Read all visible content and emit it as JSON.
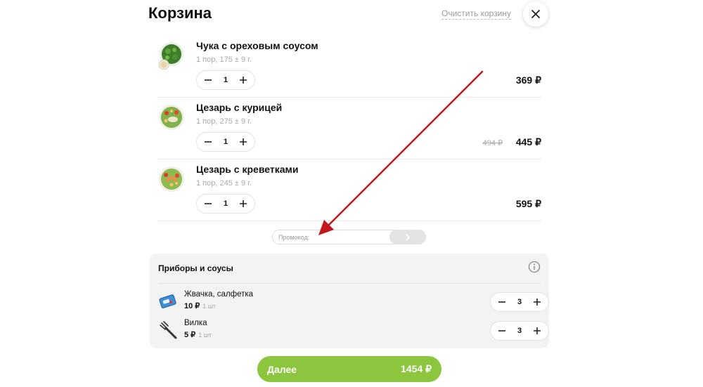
{
  "header": {
    "title": "Корзина",
    "clear_label": "Очистить корзину"
  },
  "items": [
    {
      "name": "Чука с ореховым соусом",
      "meta": "1 пор,  175 ± 9 г.",
      "qty": "1",
      "price": "369  ₽",
      "old_price": ""
    },
    {
      "name": "Цезарь с курицей",
      "meta": "1 пор,  275 ± 9 г.",
      "qty": "1",
      "price": "445  ₽",
      "old_price": "494 ₽"
    },
    {
      "name": "Цезарь с креветками",
      "meta": "1 пор,  245 ± 9 г.",
      "qty": "1",
      "price": "595  ₽",
      "old_price": ""
    }
  ],
  "promo": {
    "placeholder": "Промокод:",
    "value": ""
  },
  "extras": {
    "title": "Приборы и соусы",
    "items": [
      {
        "name": "Жвачка, салфетка",
        "price": "10 ₽",
        "unit": "1 шт",
        "qty": "3"
      },
      {
        "name": "Вилка",
        "price": "5 ₽",
        "unit": "1 шт",
        "qty": "3"
      }
    ]
  },
  "checkout": {
    "label": "Далее",
    "total": "1454 ₽"
  },
  "colors": {
    "accent": "#8cc63f",
    "annotation_arrow": "#c4171c"
  },
  "icons": [
    "close-icon",
    "minus-icon",
    "plus-icon",
    "chevron-right-icon",
    "info-icon",
    "gum-napkin-icon",
    "fork-icon"
  ]
}
